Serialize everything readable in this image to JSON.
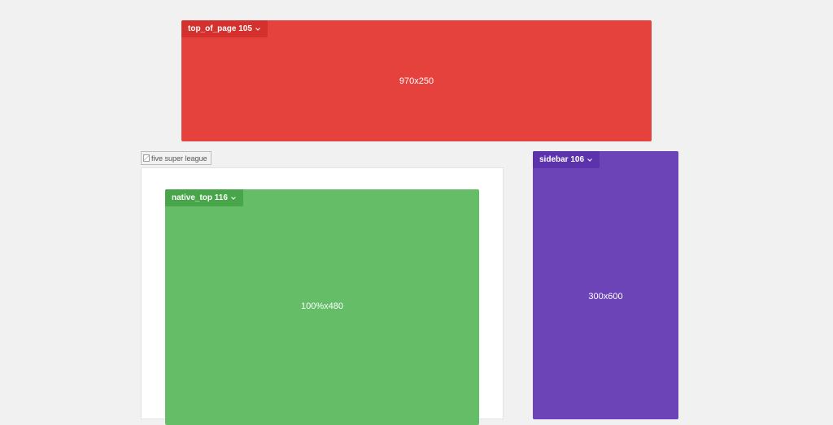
{
  "colors": {
    "page_background": "#f1f1f1",
    "top_of_page": "#e5423e",
    "native_top": "#65bd67",
    "sidebar": "#6d44b8"
  },
  "ad_slots": {
    "top_of_page": {
      "label": "top_of_page 105",
      "size": "970x250",
      "icon": "chevron-down-icon"
    },
    "native_top": {
      "label": "native_top 116",
      "size": "100%x480",
      "icon": "chevron-down-icon"
    },
    "sidebar": {
      "label": "sidebar 106",
      "size": "300x600",
      "icon": "chevron-down-icon"
    }
  },
  "broken_image": {
    "alt": "five super league",
    "icon": "broken-image-icon"
  }
}
